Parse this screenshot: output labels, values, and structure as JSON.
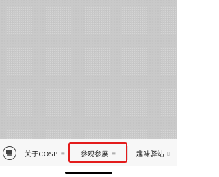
{
  "menu": {
    "items": [
      {
        "label": "关于COSP",
        "glyph": "≡"
      },
      {
        "label": "参观参展",
        "glyph": "≡"
      },
      {
        "label": "趣味驿站",
        "glyph": "▯"
      }
    ],
    "highlighted_item": "参观参展"
  },
  "colors": {
    "content_background": "#c9c9c9",
    "menu_background": "#f7f7f7",
    "highlight_border": "#e31b1b",
    "home_indicator": "#000000"
  },
  "icons": {
    "keyboard_toggle": "keyboard-icon",
    "menu_glyph": "menu-lines-icon"
  }
}
